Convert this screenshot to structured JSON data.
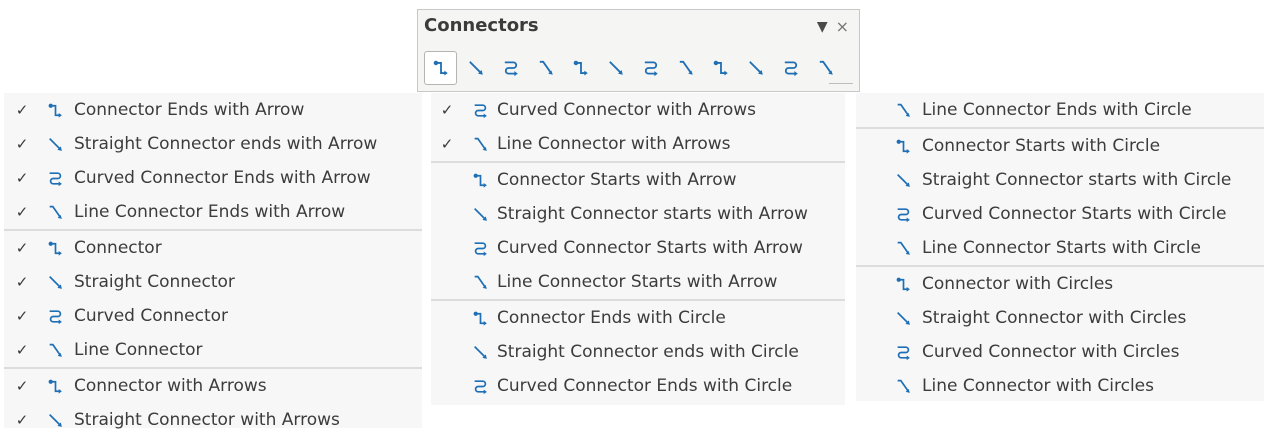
{
  "toolbar": {
    "title": "Connectors",
    "dropdown_glyph": "▼",
    "close_glyph": "×",
    "buttons": [
      {
        "icon": "connector-ends-with-arrow-icon",
        "shape": "stand",
        "active": true
      },
      {
        "icon": "straight-connector-ends-with-arrow-icon",
        "shape": "straight",
        "active": false
      },
      {
        "icon": "curved-connector-ends-with-arrow-icon",
        "shape": "curved",
        "active": false
      },
      {
        "icon": "line-connector-ends-with-arrow-icon",
        "shape": "line",
        "active": false
      },
      {
        "icon": "connector-icon",
        "shape": "stand",
        "active": false
      },
      {
        "icon": "straight-connector-icon",
        "shape": "straight",
        "active": false
      },
      {
        "icon": "curved-connector-icon",
        "shape": "curved",
        "active": false
      },
      {
        "icon": "line-connector-icon",
        "shape": "line",
        "active": false
      },
      {
        "icon": "connector-with-arrows-icon",
        "shape": "stand",
        "active": false
      },
      {
        "icon": "straight-connector-with-arrows-icon",
        "shape": "straight",
        "active": false
      },
      {
        "icon": "curved-connector-with-arrows-icon",
        "shape": "curved",
        "active": false
      },
      {
        "icon": "line-connector-with-arrows-icon",
        "shape": "line",
        "active": false
      }
    ]
  },
  "menus": {
    "left": {
      "groups": [
        [
          {
            "label": "Connector Ends with Arrow",
            "checked": true,
            "shape": "stand"
          },
          {
            "label": "Straight Connector ends with Arrow",
            "checked": true,
            "shape": "straight"
          },
          {
            "label": "Curved Connector Ends with Arrow",
            "checked": true,
            "shape": "curved"
          },
          {
            "label": "Line Connector Ends with Arrow",
            "checked": true,
            "shape": "line"
          }
        ],
        [
          {
            "label": "Connector",
            "checked": true,
            "shape": "stand"
          },
          {
            "label": "Straight Connector",
            "checked": true,
            "shape": "straight"
          },
          {
            "label": "Curved Connector",
            "checked": true,
            "shape": "curved"
          },
          {
            "label": "Line Connector",
            "checked": true,
            "shape": "line"
          }
        ],
        [
          {
            "label": "Connector with Arrows",
            "checked": true,
            "shape": "stand"
          },
          {
            "label": "Straight Connector with Arrows",
            "checked": true,
            "shape": "straight"
          }
        ]
      ]
    },
    "middle": {
      "groups": [
        [
          {
            "label": "Curved Connector with Arrows",
            "checked": true,
            "shape": "curved"
          },
          {
            "label": "Line Connector with Arrows",
            "checked": true,
            "shape": "line"
          }
        ],
        [
          {
            "label": "Connector Starts with Arrow",
            "checked": false,
            "shape": "stand"
          },
          {
            "label": "Straight Connector starts with Arrow",
            "checked": false,
            "shape": "straight"
          },
          {
            "label": "Curved Connector Starts with Arrow",
            "checked": false,
            "shape": "curved"
          },
          {
            "label": "Line Connector Starts with Arrow",
            "checked": false,
            "shape": "line"
          }
        ],
        [
          {
            "label": "Connector Ends with Circle",
            "checked": false,
            "shape": "stand"
          },
          {
            "label": "Straight Connector ends with Circle",
            "checked": false,
            "shape": "straight"
          },
          {
            "label": "Curved Connector Ends with Circle",
            "checked": false,
            "shape": "curved"
          }
        ]
      ]
    },
    "right": {
      "groups": [
        [
          {
            "label": "Line Connector Ends with Circle",
            "checked": false,
            "shape": "line"
          }
        ],
        [
          {
            "label": "Connector Starts with Circle",
            "checked": false,
            "shape": "stand"
          },
          {
            "label": "Straight Connector starts with Circle",
            "checked": false,
            "shape": "straight"
          },
          {
            "label": "Curved Connector Starts with Circle",
            "checked": false,
            "shape": "curved"
          },
          {
            "label": "Line Connector Starts with Circle",
            "checked": false,
            "shape": "line"
          }
        ],
        [
          {
            "label": "Connector with Circles",
            "checked": false,
            "shape": "stand"
          },
          {
            "label": "Straight Connector with Circles",
            "checked": false,
            "shape": "straight"
          },
          {
            "label": "Curved Connector with Circles",
            "checked": false,
            "shape": "curved"
          },
          {
            "label": "Line Connector with Circles",
            "checked": false,
            "shape": "line"
          }
        ]
      ]
    }
  },
  "check_glyph": "✓",
  "colors": {
    "icon_blue": "#1e6fb5",
    "menu_bg": "#f7f7f7",
    "separator": "#dcdcdc"
  }
}
